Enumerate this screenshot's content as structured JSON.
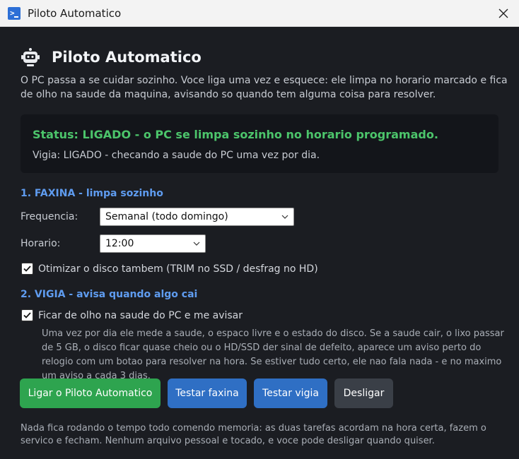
{
  "window": {
    "title": "Piloto Automatico",
    "icon": "powershell-icon",
    "close_icon": "close-icon"
  },
  "header": {
    "title": "Piloto Automatico",
    "icon": "robot-icon"
  },
  "intro": "O PC passa a se cuidar sozinho. Voce liga uma vez e esquece: ele limpa no horario marcado e fica de olho na saude da maquina, avisando so quando tem alguma coisa para resolver.",
  "status": {
    "main": "Status: LIGADO - o PC se limpa sozinho no horario programado.",
    "vigia": "Vigia: LIGADO - checando a saude do PC uma vez por dia.",
    "main_color": "#4cc56b"
  },
  "faxina": {
    "heading": "1. FAXINA - limpa sozinho",
    "frequencia_label": "Frequencia:",
    "frequencia_value": "Semanal (todo domingo)",
    "horario_label": "Horario:",
    "horario_value": "12:00",
    "otimizar_label": "Otimizar o disco tambem (TRIM no SSD / desfrag no HD)",
    "otimizar_checked": true
  },
  "vigia": {
    "heading": "2. VIGIA - avisa quando algo cai",
    "check_label": "Ficar de olho na saude do PC e me avisar",
    "checked": true,
    "description": "Uma vez por dia ele mede a saude, o espaco livre e o estado do disco. Se a saude cair, o lixo passar de 5 GB, o disco ficar quase cheio ou o HD/SSD der sinal de defeito, aparece um aviso perto do relogio com um botao para resolver na hora. Se estiver tudo certo, ele nao fala nada - e no maximo um aviso a cada 3 dias."
  },
  "buttons": {
    "ligar": "Ligar o Piloto Automatico",
    "testar_faxina": "Testar faxina",
    "testar_vigia": "Testar vigia",
    "desligar": "Desligar"
  },
  "footer": "Nada fica rodando o tempo todo comendo memoria: as duas tarefas acordam na hora certa, fazem o servico e fecham. Nenhum arquivo pessoal e tocado, e voce pode desligar quando quiser.",
  "colors": {
    "accent_blue": "#5f9cf0",
    "green_button": "#2ea44f",
    "blue_button": "#2f6fc4",
    "gray_button": "#3a3f47",
    "background": "#1b1d22"
  }
}
